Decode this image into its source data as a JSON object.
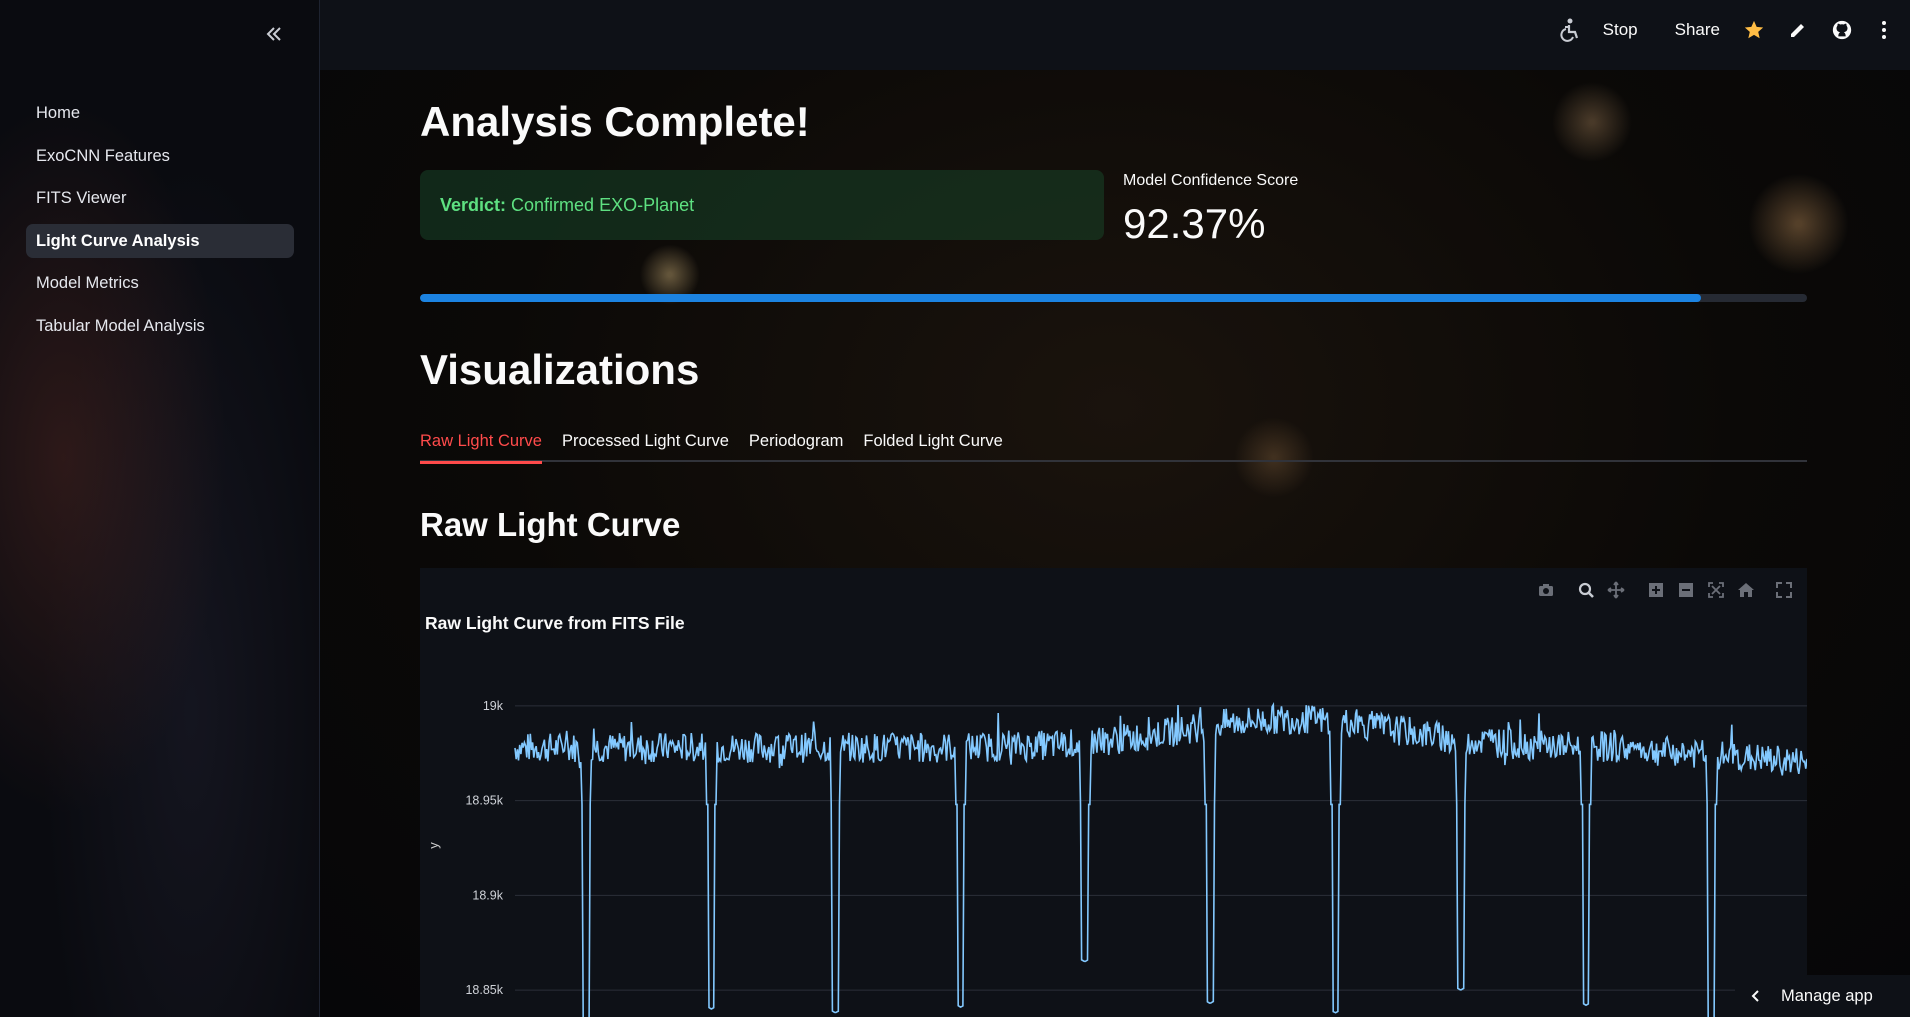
{
  "sidebar": {
    "items": [
      {
        "label": "Home"
      },
      {
        "label": "ExoCNN Features"
      },
      {
        "label": "FITS Viewer"
      },
      {
        "label": "Light Curve Analysis"
      },
      {
        "label": "Model Metrics"
      },
      {
        "label": "Tabular Model Analysis"
      }
    ],
    "active_index": 3
  },
  "header": {
    "stop_label": "Stop",
    "share_label": "Share",
    "icons": [
      "accessibility-icon",
      "star-icon",
      "pencil-icon",
      "github-icon",
      "more-vertical-icon"
    ]
  },
  "main": {
    "title": "Analysis Complete!",
    "verdict_label": "Verdict:",
    "verdict_value": "Confirmed EXO-Planet",
    "metric_label": "Model Confidence Score",
    "metric_value": "92.37%",
    "progress": 0.9237,
    "section_title": "Visualizations",
    "tabs": [
      {
        "label": "Raw Light Curve"
      },
      {
        "label": "Processed Light Curve"
      },
      {
        "label": "Periodogram"
      },
      {
        "label": "Folded Light Curve"
      }
    ],
    "active_tab": 0,
    "subsection_title": "Raw Light Curve"
  },
  "chart_data": {
    "type": "line",
    "title": "Raw Light Curve from FITS File",
    "xlabel": "",
    "ylabel": "y",
    "ylim": [
      18830,
      19020
    ],
    "yticks": [
      "19k",
      "18.95k",
      "18.9k",
      "18.85k"
    ],
    "ytick_values": [
      19000,
      18950,
      18900,
      18850
    ],
    "grid": true,
    "line_color": "#83c9ff",
    "series": [
      {
        "baseline": 18978,
        "noise": 8,
        "dip_positions": [
          0.055,
          0.152,
          0.248,
          0.345,
          0.441,
          0.538,
          0.635,
          0.732,
          0.829,
          0.926
        ],
        "dip_values": [
          18833,
          18840,
          18838,
          18841,
          18865,
          18843,
          18838,
          18850,
          18842,
          18833
        ]
      }
    ]
  },
  "modebar_icons": [
    "camera-icon",
    "zoom-icon",
    "pan-icon",
    "zoom-in-icon",
    "zoom-out-icon",
    "autoscale-icon",
    "reset-axes-icon",
    "fullscreen-icon"
  ],
  "manage_app_label": "Manage app"
}
